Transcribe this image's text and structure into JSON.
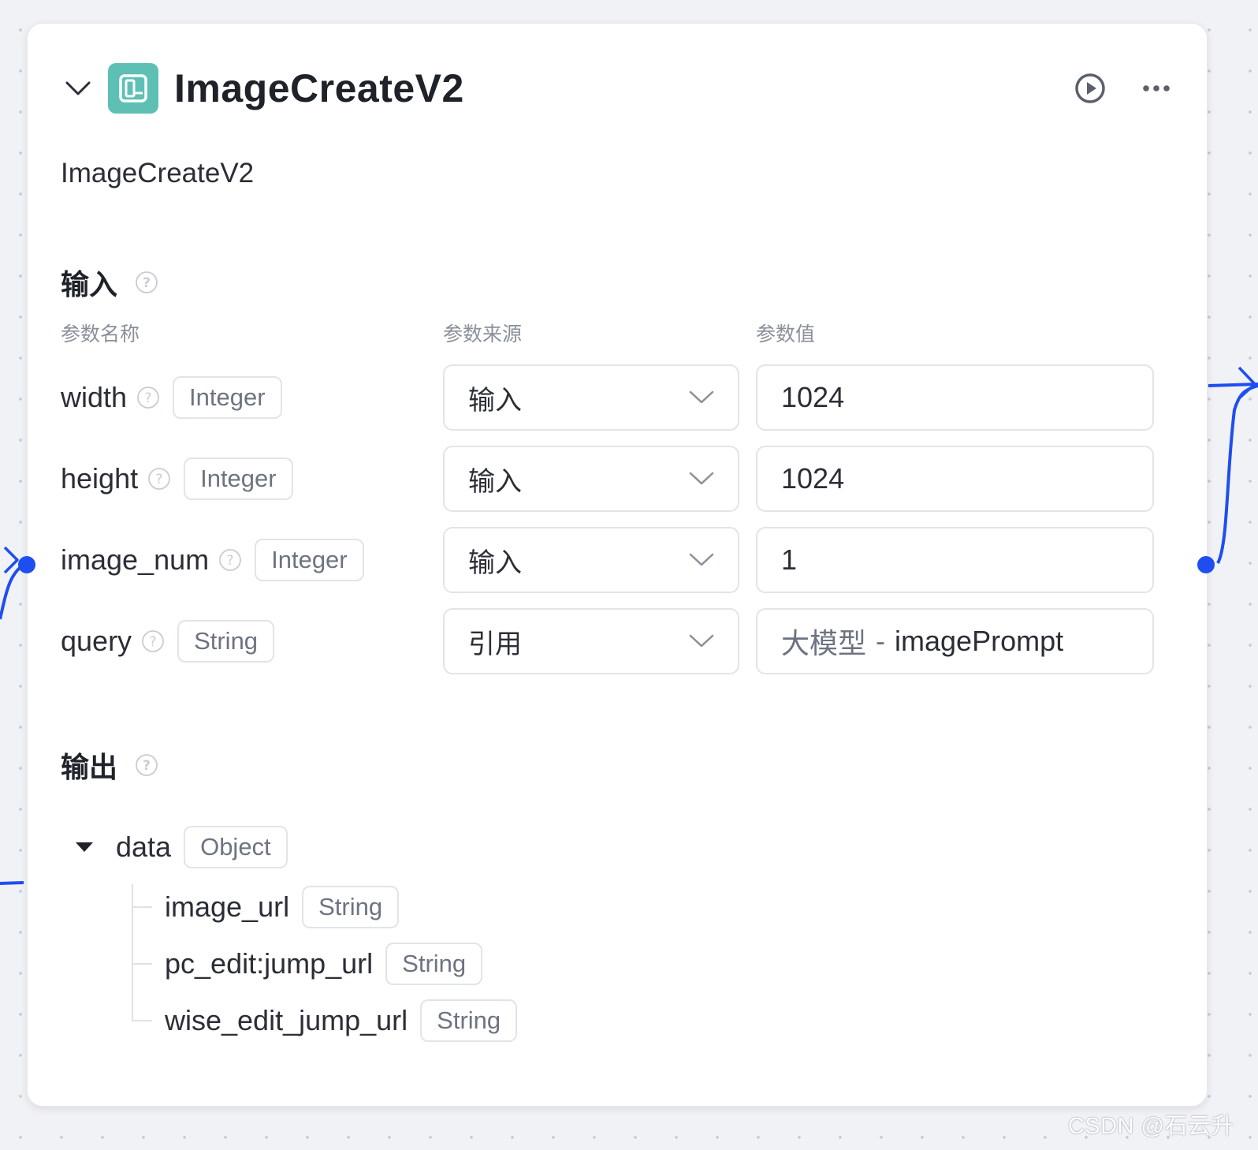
{
  "node": {
    "title": "ImageCreateV2",
    "description": "ImageCreateV2",
    "icon": "image-plugin-icon",
    "accent_color": "#5ec0b4"
  },
  "header_actions": {
    "run_icon": "play-circle-icon",
    "more_icon": "more-dots-icon"
  },
  "input": {
    "section_title": "输入",
    "column_headers": {
      "name": "参数名称",
      "source": "参数来源",
      "value": "参数值"
    },
    "params": [
      {
        "name": "width",
        "type": "Integer",
        "source": "输入",
        "value": "1024"
      },
      {
        "name": "height",
        "type": "Integer",
        "source": "输入",
        "value": "1024"
      },
      {
        "name": "image_num",
        "type": "Integer",
        "source": "输入",
        "value": "1"
      },
      {
        "name": "query",
        "type": "String",
        "source": "引用",
        "value_ref": {
          "node": "大模型",
          "separator": "-",
          "field": "imagePrompt"
        }
      }
    ]
  },
  "output": {
    "section_title": "输出",
    "root": {
      "name": "data",
      "type": "Object"
    },
    "children": [
      {
        "name": "image_url",
        "type": "String"
      },
      {
        "name": "pc_edit:jump_url",
        "type": "String"
      },
      {
        "name": "wise_edit_jump_url",
        "type": "String"
      }
    ]
  },
  "connection_color": "#1f4ef0",
  "watermark": "CSDN @石云升"
}
